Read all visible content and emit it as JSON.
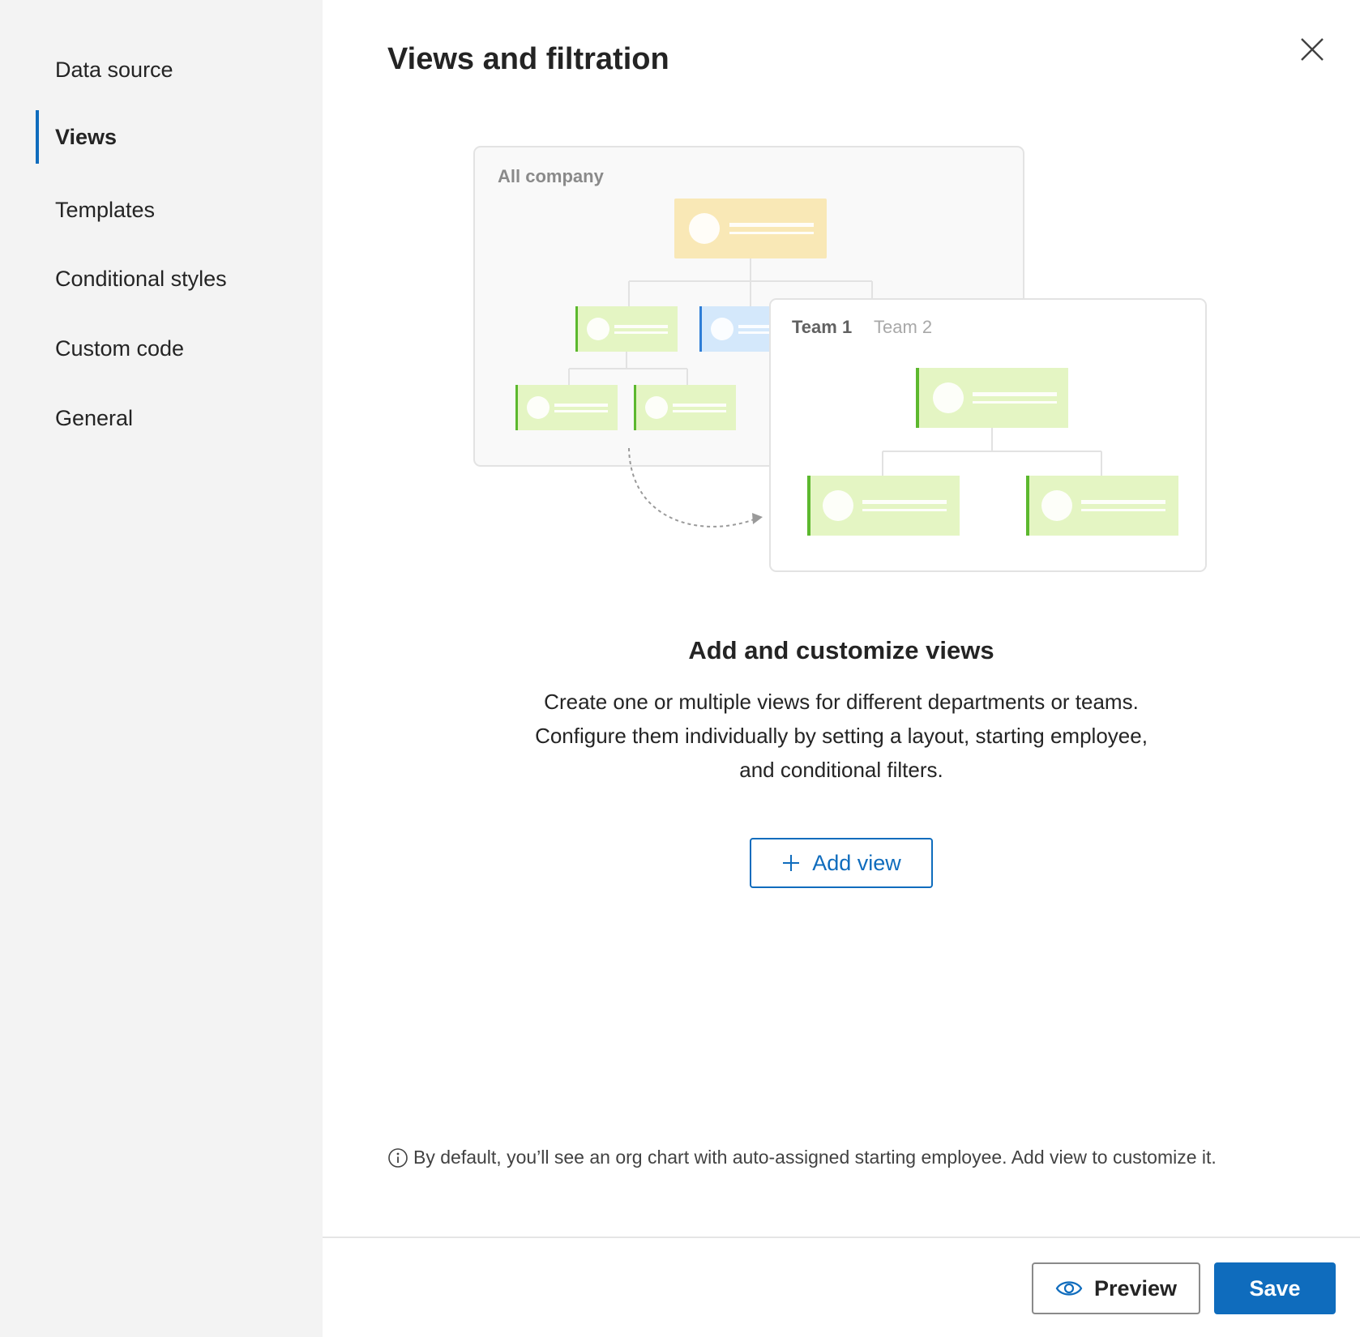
{
  "sidebar": {
    "items": [
      {
        "label": "Data source",
        "active": false
      },
      {
        "label": "Views",
        "active": true
      },
      {
        "label": "Templates",
        "active": false
      },
      {
        "label": "Conditional styles",
        "active": false
      },
      {
        "label": "Custom code",
        "active": false
      },
      {
        "label": "General",
        "active": false
      }
    ]
  },
  "main": {
    "title": "Views and filtration",
    "illustration": {
      "all_company_label": "All company",
      "team1_label": "Team 1",
      "team2_label": "Team 2"
    },
    "heading": "Add and customize views",
    "description": [
      "Create one or multiple views for different departments or teams.",
      "Configure them individually by setting a layout, starting employee,",
      "and conditional filters."
    ],
    "add_view_label": "Add view",
    "info_note": "By default, you’ll see an org chart with auto-assigned starting employee. Add view to customize it."
  },
  "footer": {
    "preview_label": "Preview",
    "save_label": "Save"
  },
  "colors": {
    "accent": "#0f6cbd",
    "sidebar_bg": "#f3f3f3",
    "card_green": "#e4f5c3",
    "card_green_border": "#5cb82e",
    "card_yellow": "#f9e8b6",
    "card_blue": "#d4e8fb"
  }
}
